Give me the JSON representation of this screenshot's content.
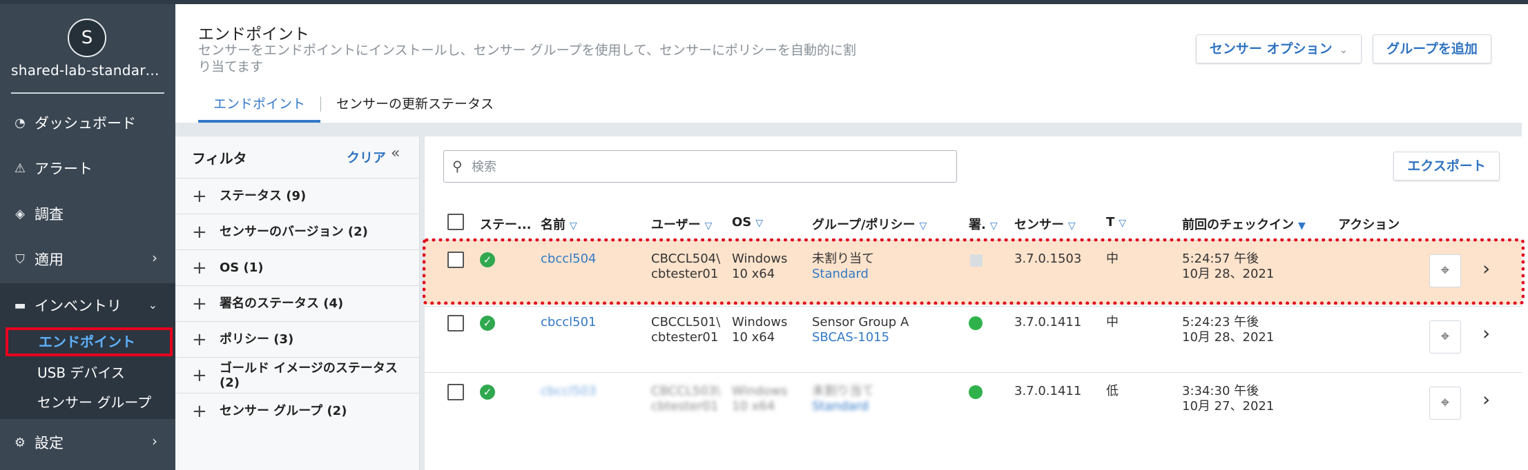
{
  "sidebar": {
    "avatar_letter": "S",
    "org_name": "shared-lab-standard-...",
    "nav": [
      {
        "label": "ダッシュボード",
        "icon": "gauge-icon"
      },
      {
        "label": "アラート",
        "icon": "warning-icon"
      },
      {
        "label": "調査",
        "icon": "investigate-icon"
      },
      {
        "label": "適用",
        "icon": "shield-check-icon"
      },
      {
        "label": "インベントリ",
        "icon": "laptop-icon"
      },
      {
        "label": "設定",
        "icon": "gear-icon"
      }
    ],
    "sub": [
      {
        "label": "エンドポイント"
      },
      {
        "label": "USB デバイス"
      },
      {
        "label": "センサー グループ"
      }
    ]
  },
  "header": {
    "title": "エンドポイント",
    "description": "センサーをエンドポイントにインストールし、センサー グループを使用して、センサーにポリシーを自動的に割り当てます",
    "tabs": [
      {
        "label": "エンドポイント"
      },
      {
        "label": "センサーの更新ステータス"
      }
    ],
    "sensor_options_label": "センサー オプション",
    "add_group_label": "グループを追加"
  },
  "filter": {
    "title": "フィルタ",
    "clear_label": "クリア",
    "collapse_icon": "«",
    "items": [
      {
        "label": "ステータス (9)"
      },
      {
        "label": "センサーのバージョン (2)"
      },
      {
        "label": "OS (1)"
      },
      {
        "label": "署名のステータス (4)"
      },
      {
        "label": "ポリシー (3)"
      },
      {
        "label": "ゴールド イメージのステータス (2)"
      },
      {
        "label": "センサー グループ (2)"
      }
    ]
  },
  "main": {
    "search_placeholder": "検索",
    "export_label": "エクスポート",
    "columns": {
      "status": "ステー...",
      "name": "名前",
      "user": "ユーザー",
      "os": "OS",
      "group_policy": "グループ/ポリシー",
      "signature": "署.",
      "sensor": "センサー",
      "t": "T",
      "last_checkin": "前回のチェックイン",
      "action": "アクション"
    },
    "rows": [
      {
        "name": "cbccl504",
        "user_line1": "CBCCL504\\",
        "user_line2": "cbtester01",
        "os_line1": "Windows",
        "os_line2": "10 x64",
        "group": "未割り当て",
        "policy": "Standard",
        "sensor": "3.7.0.1503",
        "t": "中",
        "time": "5:24:57 午後",
        "date": "10月 28、2021"
      },
      {
        "name": "cbccl501",
        "user_line1": "CBCCL501\\",
        "user_line2": "cbtester01",
        "os_line1": "Windows",
        "os_line2": "10 x64",
        "group": "Sensor Group A",
        "policy": "SBCAS-1015",
        "sensor": "3.7.0.1411",
        "t": "中",
        "time": "5:24:23 午後",
        "date": "10月 28、2021"
      },
      {
        "name": "cbccl503",
        "user_line1": "CBCCL503\\",
        "user_line2": "cbtester01",
        "os_line1": "Windows",
        "os_line2": "10 x64",
        "group": "未割り当て",
        "policy": "Standard",
        "sensor": "3.7.0.1411",
        "t": "低",
        "time": "3:34:30 午後",
        "date": "10月 27、2021"
      }
    ]
  },
  "colors": {
    "sidebar_bg": "#3a4652",
    "accent": "#3379c7",
    "highlight_row": "#fde3cc",
    "annotation_red": "#e0001b",
    "status_green": "#2fa84f"
  }
}
